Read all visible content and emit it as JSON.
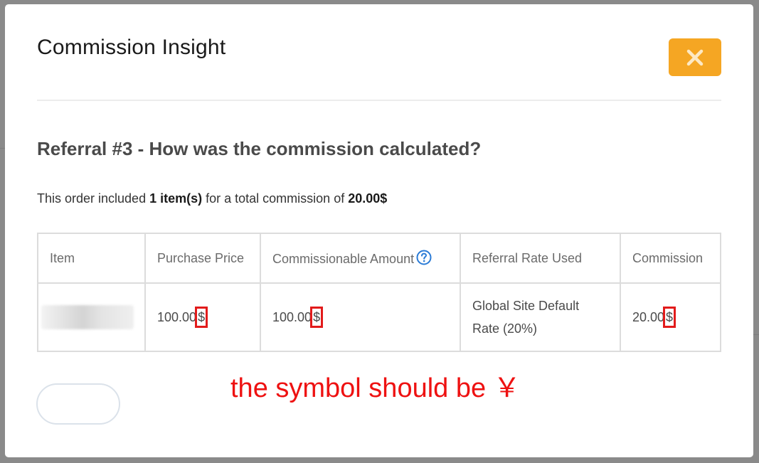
{
  "modal": {
    "title": "Commission Insight",
    "close_label": "×"
  },
  "heading": "Referral #3 - How was the commission calculated?",
  "summary": {
    "prefix": "This order included ",
    "items": "1 item(s)",
    "middle": " for a total commission of ",
    "total": "20.00$"
  },
  "table": {
    "headers": [
      "Item",
      "Purchase Price",
      "Commissionable Amount",
      "Referral Rate Used",
      "Commission"
    ],
    "row": {
      "purchase_price": "100.00",
      "commissionable_amount": "100.00",
      "rate_line1": "Global Site Default",
      "rate_line2": "Rate (20%)",
      "commission": "20.00",
      "currency_symbol": "$"
    }
  },
  "annotation": "the symbol should be ￥",
  "colors": {
    "close_button": "#f5a623",
    "help_icon": "#2a7bd6",
    "highlight_box": "#e21b1b",
    "annotation_text": "#ee1111"
  },
  "icons": [
    "close-icon",
    "help-circle-icon"
  ]
}
